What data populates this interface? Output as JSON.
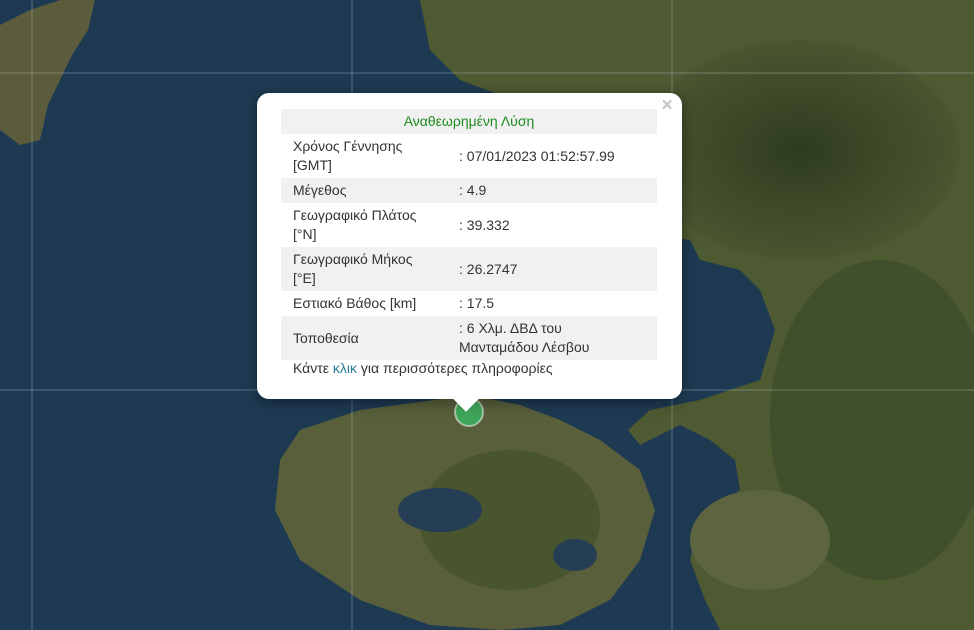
{
  "popup": {
    "title": "Αναθεωρημένη Λύση",
    "close_symbol": "×",
    "rows": [
      {
        "label": "Χρόνος Γέννησης [GMT]",
        "value": ": 07/01/2023 01:52:57.99"
      },
      {
        "label": "Μέγεθος",
        "value": ": 4.9"
      },
      {
        "label": "Γεωγραφικό Πλάτος [°N]",
        "value": ": 39.332"
      },
      {
        "label": "Γεωγραφικό Μήκος [°E]",
        "value": ": 26.2747"
      },
      {
        "label": "Εστιακό Βάθος [km]",
        "value": ": 17.5"
      },
      {
        "label": "Τοποθεσία",
        "value": ": 6 Χλμ. ΔΒΔ του Μανταμάδου Λέσβου"
      }
    ],
    "more_prefix": "Κάντε ",
    "more_link": "κλικ",
    "more_suffix": " για περισσότερες πληροφορίες"
  },
  "map": {
    "marker_icon": "earthquake-marker-icon",
    "marker_color": "#3fa55a",
    "sea_color": "#1e3a52",
    "land_color": "#4f5a34"
  }
}
